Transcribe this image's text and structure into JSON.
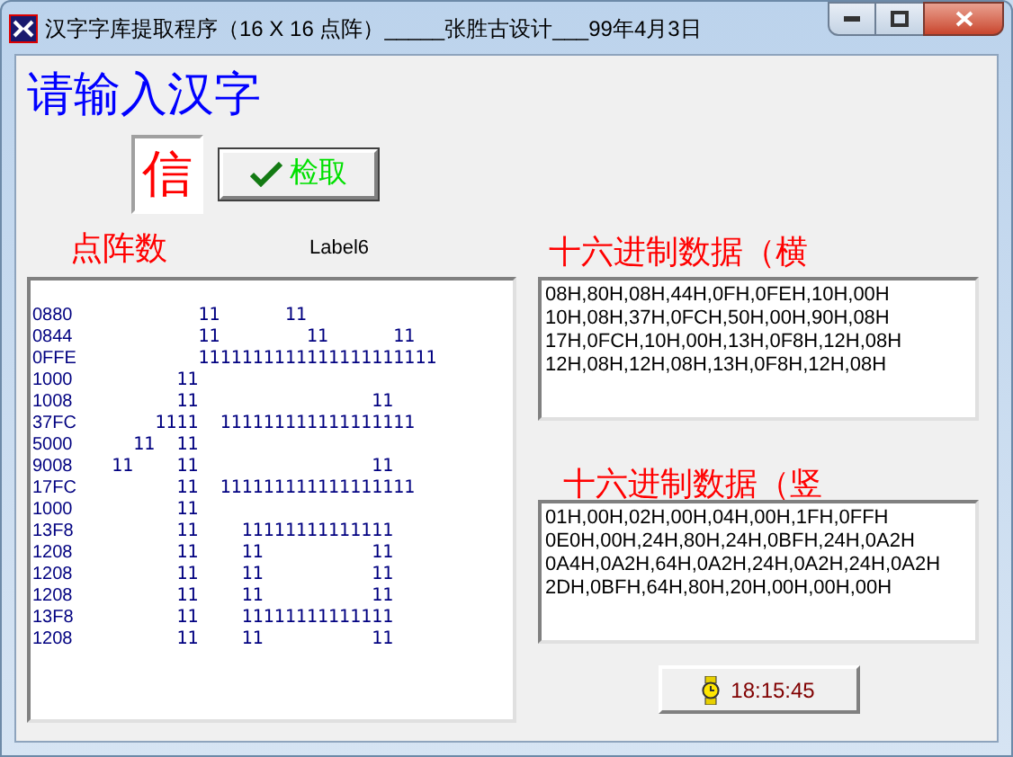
{
  "window": {
    "title": "汉字字库提取程序（16 X 16 点阵）_____张胜古设计___99年4月3日"
  },
  "heading": "请输入汉字",
  "char_input": {
    "value": "信"
  },
  "extract_button": {
    "label": "检取"
  },
  "matrix_label": "点阵数",
  "label6": "Label6",
  "matrix_rows": [
    {
      "code": "0880",
      "pattern": "        11      11"
    },
    {
      "code": "0844",
      "pattern": "        11        11      11"
    },
    {
      "code": "0FFE",
      "pattern": "        1111111111111111111111"
    },
    {
      "code": "1000",
      "pattern": "      11"
    },
    {
      "code": "1008",
      "pattern": "      11                11"
    },
    {
      "code": "37FC",
      "pattern": "    1111  111111111111111111"
    },
    {
      "code": "5000",
      "pattern": "  11  11"
    },
    {
      "code": "9008",
      "pattern": "11    11                11"
    },
    {
      "code": "17FC",
      "pattern": "      11  111111111111111111"
    },
    {
      "code": "1000",
      "pattern": "      11"
    },
    {
      "code": "13F8",
      "pattern": "      11    11111111111111"
    },
    {
      "code": "1208",
      "pattern": "      11    11          11"
    },
    {
      "code": "1208",
      "pattern": "      11    11          11"
    },
    {
      "code": "1208",
      "pattern": "      11    11          11"
    },
    {
      "code": "13F8",
      "pattern": "      11    11111111111111"
    },
    {
      "code": "1208",
      "pattern": "      11    11          11"
    }
  ],
  "horizontal": {
    "label": "十六进制数据（横",
    "lines": [
      "08H,80H,08H,44H,0FH,0FEH,10H,00H",
      "10H,08H,37H,0FCH,50H,00H,90H,08H",
      "17H,0FCH,10H,00H,13H,0F8H,12H,08H",
      "12H,08H,12H,08H,13H,0F8H,12H,08H"
    ]
  },
  "vertical": {
    "label": "十六进制数据（竖",
    "lines": [
      "01H,00H,02H,00H,04H,00H,1FH,0FFH",
      "0E0H,00H,24H,80H,24H,0BFH,24H,0A2H",
      "0A4H,0A2H,64H,0A2H,24H,0A2H,24H,0A2H",
      "2DH,0BFH,64H,80H,20H,00H,00H,00H"
    ]
  },
  "clock_button": {
    "label": "18:15:45"
  }
}
